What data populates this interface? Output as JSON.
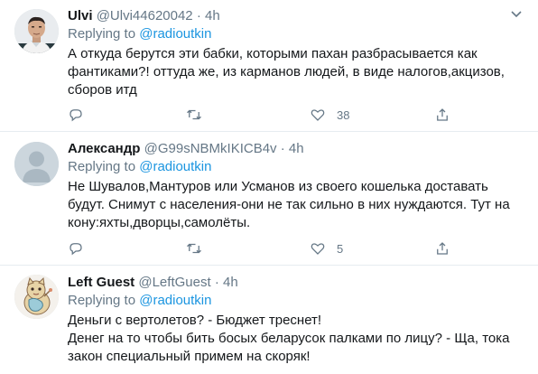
{
  "colors": {
    "link": "#1b95e0",
    "secondary": "#657786",
    "divider": "#e6ecf0"
  },
  "tweets": [
    {
      "name": "Ulvi",
      "handle": "@Ulvi44620042",
      "sep": "·",
      "time": "4h",
      "replying_prefix": "Replying to ",
      "replying_to": "@radioutkin",
      "text": "А откуда берутся эти бабки, которыми пахан разбрасывается как фантиками?! оттуда же, из карманов людей, в виде налогов,акцизов, сборов итд",
      "like_count": "38"
    },
    {
      "name": "Александр",
      "handle": "@G99sNBMkIKICB4v",
      "sep": "·",
      "time": "4h",
      "replying_prefix": "Replying to ",
      "replying_to": "@radioutkin",
      "text": "Не Шувалов,Мантуров или Усманов из своего кошелька доставать будут. Снимут с населения-они не так сильно в них нуждаются. Тут на кону:яхты,дворцы,самолёты.",
      "like_count": "5"
    },
    {
      "name": "Left Guest",
      "handle": "@LeftGuest",
      "sep": "·",
      "time": "4h",
      "replying_prefix": "Replying to ",
      "replying_to": "@radioutkin",
      "text_line1": "Деньги с вертолетов? - Бюджет треснет!",
      "text_line2": "Денег на то чтобы бить босых беларусок палками по лицу? - Ща, тока закон специальный примем на скоряк!"
    }
  ],
  "icons": [
    "chevron-down-icon",
    "reply-icon",
    "retweet-icon",
    "like-icon",
    "share-icon"
  ]
}
